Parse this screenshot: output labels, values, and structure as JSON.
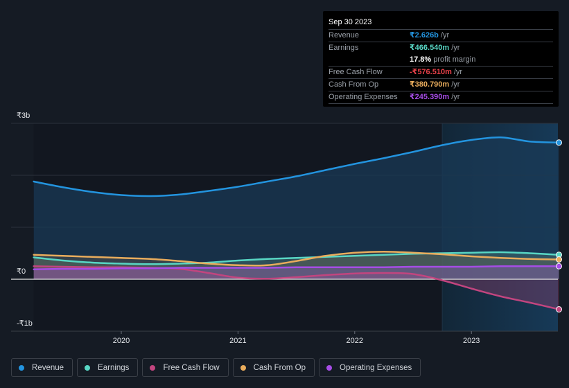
{
  "tooltip": {
    "date": "Sep 30 2023",
    "rows": [
      {
        "label": "Revenue",
        "value": "₹2.626b",
        "unit": "/yr",
        "color": "#2394df"
      },
      {
        "label": "Earnings",
        "value": "₹466.540m",
        "unit": "/yr",
        "color": "#58d6c4"
      },
      {
        "label": "",
        "value": "17.8%",
        "unit": "profit margin",
        "color": "#ffffff"
      },
      {
        "label": "Free Cash Flow",
        "value": "-₹576.510m",
        "unit": "/yr",
        "color": "#e8414a"
      },
      {
        "label": "Cash From Op",
        "value": "₹380.790m",
        "unit": "/yr",
        "color": "#e9ac5c"
      },
      {
        "label": "Operating Expenses",
        "value": "₹245.390m",
        "unit": "/yr",
        "color": "#a64de6"
      }
    ]
  },
  "legend": [
    {
      "label": "Revenue",
      "color": "#2394df"
    },
    {
      "label": "Earnings",
      "color": "#58d6c4"
    },
    {
      "label": "Free Cash Flow",
      "color": "#c2457f"
    },
    {
      "label": "Cash From Op",
      "color": "#e9ac5c"
    },
    {
      "label": "Operating Expenses",
      "color": "#a64de6"
    }
  ],
  "chart_data": {
    "type": "area",
    "title": "",
    "xlabel": "",
    "ylabel": "",
    "y_unit": "₹ billions",
    "ylim": [
      -1,
      3
    ],
    "y_ticks": [
      {
        "value": 3,
        "label": "₹3b"
      },
      {
        "value": 0,
        "label": "₹0"
      },
      {
        "value": -1,
        "label": "-₹1b"
      }
    ],
    "x_ticks": [
      {
        "value": 2020,
        "label": "2020"
      },
      {
        "value": 2021,
        "label": "2021"
      },
      {
        "value": 2022,
        "label": "2022"
      },
      {
        "value": 2023,
        "label": "2023"
      }
    ],
    "xlim": [
      2019.24,
      2023.75
    ],
    "highlight_from": 2022.75,
    "grid": true,
    "legend_position": "bottom",
    "x": [
      2019.25,
      2019.5,
      2019.75,
      2020.0,
      2020.25,
      2020.5,
      2020.75,
      2021.0,
      2021.25,
      2021.5,
      2021.75,
      2022.0,
      2022.25,
      2022.5,
      2022.75,
      2023.0,
      2023.25,
      2023.5,
      2023.75
    ],
    "series": [
      {
        "name": "Revenue",
        "color": "#2394df",
        "values": [
          1.88,
          1.77,
          1.68,
          1.62,
          1.6,
          1.63,
          1.7,
          1.78,
          1.88,
          1.98,
          2.1,
          2.22,
          2.33,
          2.45,
          2.58,
          2.68,
          2.73,
          2.65,
          2.63
        ]
      },
      {
        "name": "Earnings",
        "color": "#58d6c4",
        "values": [
          0.42,
          0.36,
          0.32,
          0.3,
          0.29,
          0.3,
          0.32,
          0.36,
          0.39,
          0.41,
          0.43,
          0.45,
          0.47,
          0.49,
          0.5,
          0.51,
          0.52,
          0.5,
          0.47
        ]
      },
      {
        "name": "Free Cash Flow",
        "color": "#c2457f",
        "values": [
          0.25,
          0.24,
          0.23,
          0.23,
          0.22,
          0.2,
          0.12,
          0.03,
          0.01,
          0.04,
          0.08,
          0.11,
          0.12,
          0.1,
          -0.02,
          -0.18,
          -0.33,
          -0.45,
          -0.58
        ]
      },
      {
        "name": "Cash From Op",
        "color": "#e9ac5c",
        "values": [
          0.47,
          0.45,
          0.43,
          0.41,
          0.39,
          0.35,
          0.3,
          0.27,
          0.27,
          0.35,
          0.45,
          0.51,
          0.53,
          0.51,
          0.48,
          0.44,
          0.41,
          0.39,
          0.38
        ]
      },
      {
        "name": "Operating Expenses",
        "color": "#a64de6",
        "values": [
          0.19,
          0.2,
          0.2,
          0.21,
          0.21,
          0.22,
          0.22,
          0.22,
          0.22,
          0.23,
          0.23,
          0.23,
          0.23,
          0.24,
          0.24,
          0.24,
          0.25,
          0.25,
          0.25
        ]
      }
    ]
  }
}
